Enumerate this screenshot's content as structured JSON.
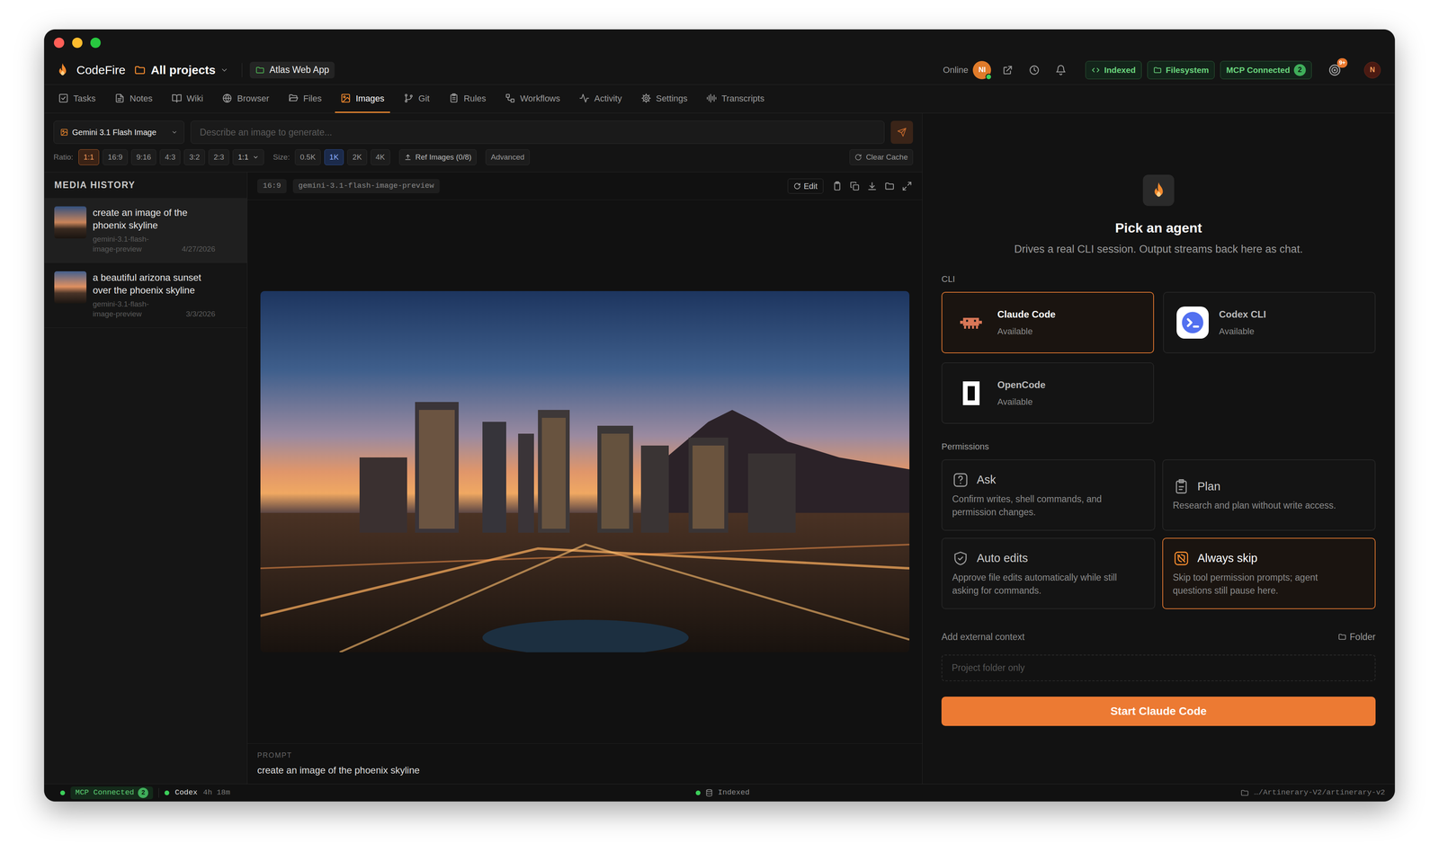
{
  "app": {
    "name": "CodeFire",
    "project_switcher": "All projects",
    "project": "Atlas Web App"
  },
  "header": {
    "presence": "Online",
    "avatar": "NI",
    "chips": [
      {
        "label": "Indexed"
      },
      {
        "label": "Filesystem"
      },
      {
        "label": "MCP Connected",
        "count": "2"
      }
    ],
    "notifications_badge": "9+",
    "user_avatar": "N"
  },
  "tabs": [
    {
      "label": "Tasks",
      "selected": false
    },
    {
      "label": "Notes",
      "selected": false
    },
    {
      "label": "Wiki",
      "selected": false
    },
    {
      "label": "Browser",
      "selected": false
    },
    {
      "label": "Files",
      "selected": false
    },
    {
      "label": "Images",
      "selected": true
    },
    {
      "label": "Git",
      "selected": false
    },
    {
      "label": "Rules",
      "selected": false
    },
    {
      "label": "Workflows",
      "selected": false
    },
    {
      "label": "Activity",
      "selected": false
    },
    {
      "label": "Settings",
      "selected": false
    },
    {
      "label": "Transcripts",
      "selected": false
    }
  ],
  "generator": {
    "model": "Gemini 3.1 Flash Image",
    "prompt_placeholder": "Describe an image to generate...",
    "ratio_label": "Ratio:",
    "ratios": [
      {
        "label": "1:1",
        "selected": true
      },
      {
        "label": "16:9",
        "selected": false
      },
      {
        "label": "9:16",
        "selected": false
      },
      {
        "label": "4:3",
        "selected": false
      },
      {
        "label": "3:2",
        "selected": false
      },
      {
        "label": "2:3",
        "selected": false
      }
    ],
    "ratio_select": "1:1",
    "size_label": "Size:",
    "sizes": [
      {
        "label": "0.5K",
        "selected": false
      },
      {
        "label": "1K",
        "selected": true
      },
      {
        "label": "2K",
        "selected": false
      },
      {
        "label": "4K",
        "selected": false
      }
    ],
    "ref_images": "Ref Images (0/8)",
    "advanced": "Advanced",
    "clear_cache": "Clear Cache"
  },
  "media_history": {
    "title": "MEDIA HISTORY",
    "items": [
      {
        "prompt": "create an image of the phoenix skyline",
        "model": "gemini-3.1-flash-image-preview",
        "date": "4/27/2026",
        "selected": true
      },
      {
        "prompt": "a beautiful arizona sunset over the phoenix skyline",
        "model": "gemini-3.1-flash-image-preview",
        "date": "3/3/2026",
        "selected": false
      }
    ]
  },
  "viewer": {
    "ratio": "16:9",
    "model": "gemini-3.1-flash-image-preview",
    "edit": "Edit",
    "prompt_label": "PROMPT",
    "prompt": "create an image of the phoenix skyline"
  },
  "agent_panel": {
    "title": "Pick an agent",
    "subtitle": "Drives a real CLI session. Output streams back here as chat.",
    "cli_label": "CLI",
    "agents": [
      {
        "name": "Claude Code",
        "status": "Available",
        "selected": true
      },
      {
        "name": "Codex CLI",
        "status": "Available",
        "selected": false
      },
      {
        "name": "OpenCode",
        "status": "Available",
        "selected": false
      }
    ],
    "permissions_label": "Permissions",
    "permissions": [
      {
        "title": "Ask",
        "description": "Confirm writes, shell commands, and permission changes.",
        "selected": false
      },
      {
        "title": "Plan",
        "description": "Research and plan without write access.",
        "selected": false
      },
      {
        "title": "Auto edits",
        "description": "Approve file edits automatically while still asking for commands.",
        "selected": false
      },
      {
        "title": "Always skip",
        "description": "Skip tool permission prompts; agent questions still pause here.",
        "selected": true
      }
    ],
    "context_label": "Add external context",
    "folder_button": "Folder",
    "context_placeholder": "Project folder only",
    "start_button": "Start Claude Code"
  },
  "status_bar": {
    "mcp": "MCP Connected",
    "mcp_count": "2",
    "session": "Codex",
    "session_time": "4h 18m",
    "index": "Indexed",
    "path": "…/Artinerary-V2/artinerary-v2"
  }
}
